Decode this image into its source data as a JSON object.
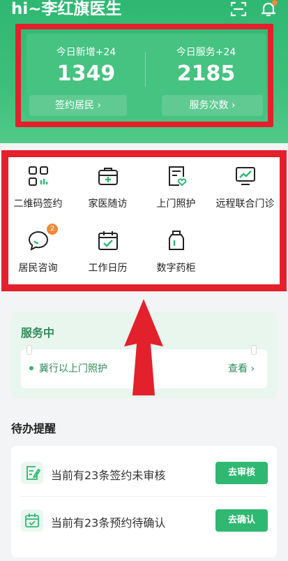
{
  "header": {
    "title": "hi~李红旗医生",
    "icons": [
      "scan-icon",
      "bell-icon"
    ],
    "notification_dot_color": "#ef8a3a"
  },
  "stats": [
    {
      "label": "今日新增+24",
      "value": "1349",
      "link": "签约居民 ›"
    },
    {
      "label": "今日服务+24",
      "value": "2185",
      "link": "服务次数 ›"
    }
  ],
  "grid": {
    "items": [
      {
        "label": "二维码签约",
        "icon": "qr-code-icon"
      },
      {
        "label": "家医随访",
        "icon": "medical-kit-icon"
      },
      {
        "label": "上门照护",
        "icon": "care-document-icon"
      },
      {
        "label": "远程联合门诊",
        "icon": "monitor-chart-icon"
      },
      {
        "label": "居民咨询",
        "icon": "chat-bubble-icon",
        "badge": "2"
      },
      {
        "label": "工作日历",
        "icon": "calendar-check-icon"
      },
      {
        "label": "数字药柜",
        "icon": "medicine-bottle-icon"
      }
    ]
  },
  "service": {
    "title": "服务中",
    "item": "冀行以上门照护",
    "action": "查看 ›"
  },
  "todo": {
    "title": "待办提醒",
    "items": [
      {
        "text": "当前有23条签约未审核",
        "button": "去审核",
        "icon": "edit-document-icon"
      },
      {
        "text": "当前有23条预约待确认",
        "button": "去确认",
        "icon": "calendar-check-icon"
      }
    ]
  },
  "colors": {
    "brand_green": "#2fb872",
    "highlight_red": "#e3212c",
    "badge_orange": "#ef8a3a"
  }
}
